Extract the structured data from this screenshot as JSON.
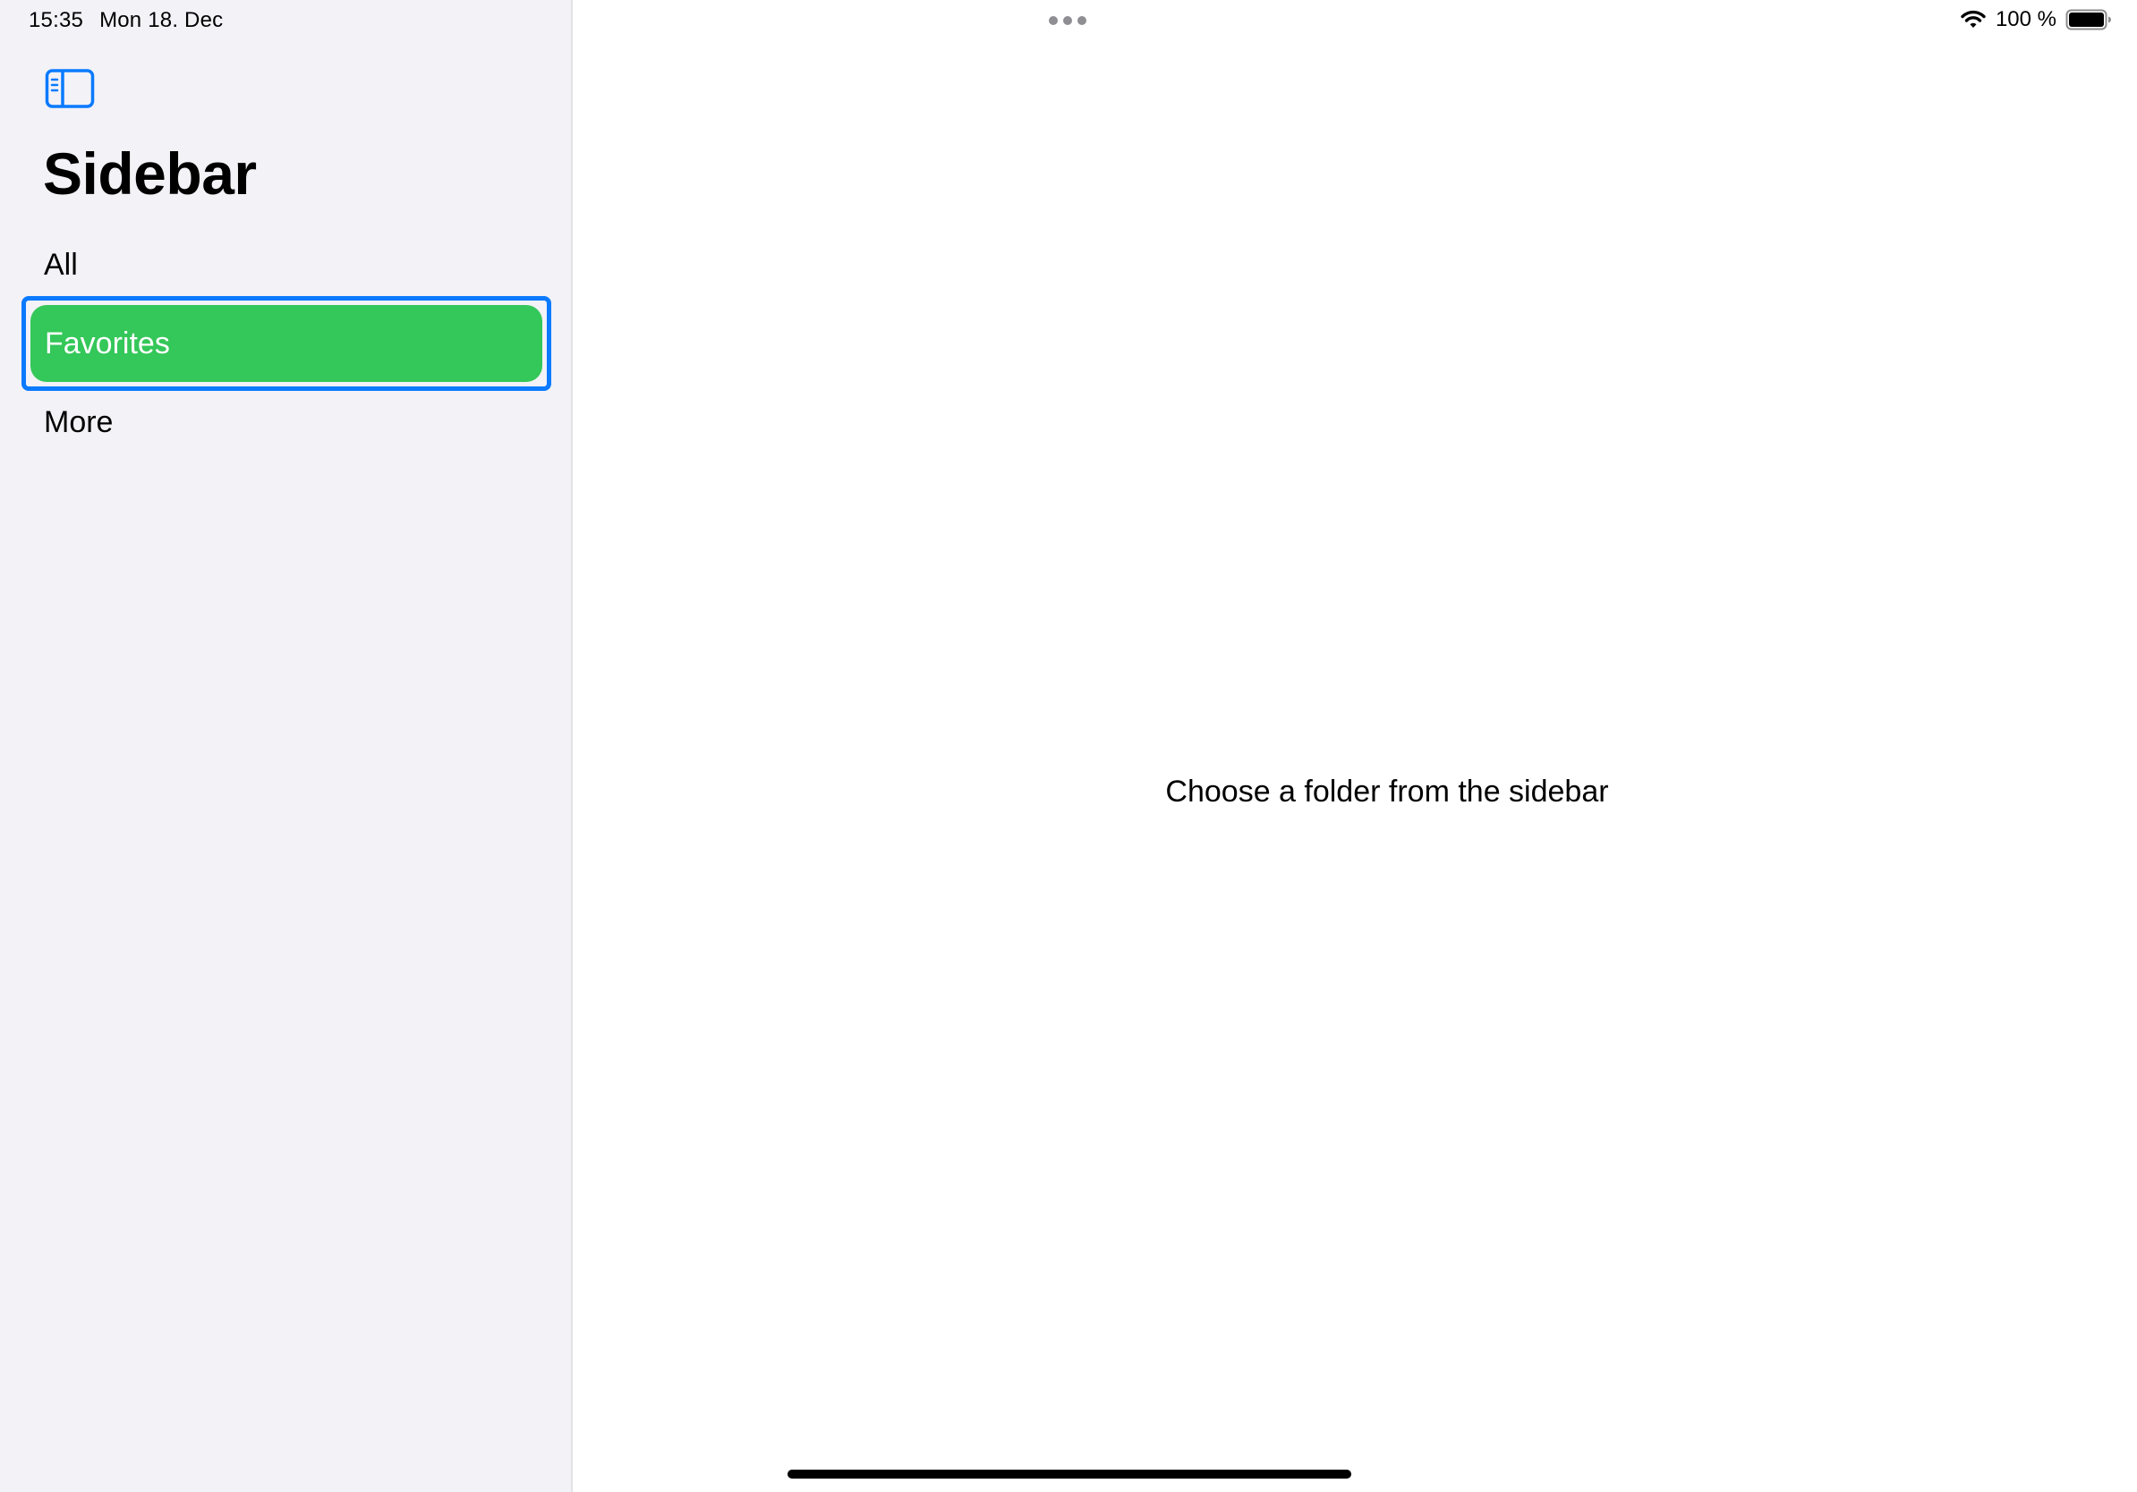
{
  "status_bar": {
    "time": "15:35",
    "date": "Mon 18. Dec",
    "battery": "100 %",
    "icons": [
      "wifi-icon",
      "battery-icon"
    ]
  },
  "sidebar": {
    "toggle_icon": "sidebar-toggle-icon",
    "title": "Sidebar",
    "items": [
      {
        "label": "All",
        "selected": false
      },
      {
        "label": "Favorites",
        "selected": true
      },
      {
        "label": "More",
        "selected": false
      }
    ]
  },
  "detail": {
    "placeholder": "Choose a folder from the sidebar"
  },
  "colors": {
    "accent": "#0a7aff",
    "selection": "#34c759",
    "sidebar_bg": "#f2f2f7"
  }
}
